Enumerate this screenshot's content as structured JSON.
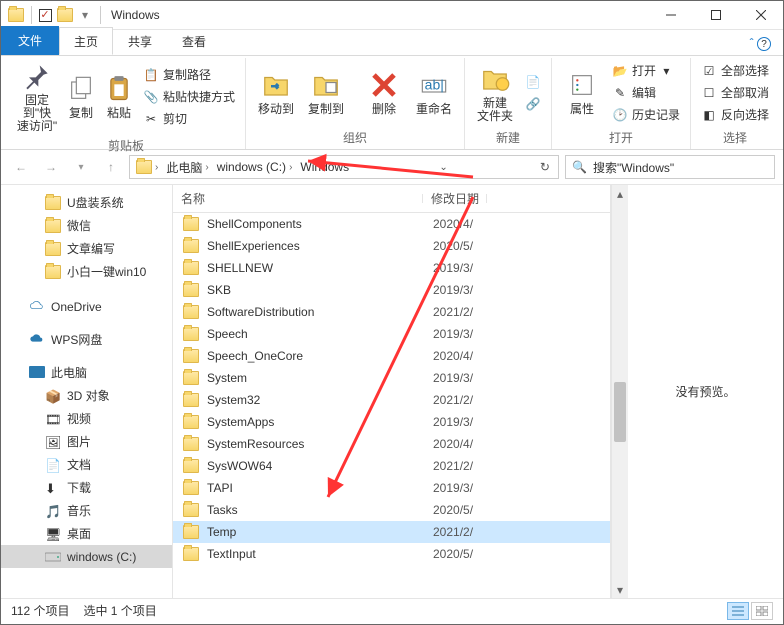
{
  "window": {
    "title": "Windows"
  },
  "tabs": {
    "file": "文件",
    "home": "主页",
    "share": "共享",
    "view": "查看"
  },
  "ribbon": {
    "clipboard": {
      "pin": "固定到\"快\n速访问\"",
      "copy": "复制",
      "paste": "粘贴",
      "copy_path": "复制路径",
      "paste_shortcut": "粘贴快捷方式",
      "cut": "剪切",
      "label": "剪贴板"
    },
    "organize": {
      "moveto": "移动到",
      "copyto": "复制到",
      "delete": "删除",
      "rename": "重命名",
      "label": "组织"
    },
    "new": {
      "newfolder": "新建\n文件夹",
      "label": "新建"
    },
    "open": {
      "props": "属性",
      "open": "打开",
      "edit": "编辑",
      "history": "历史记录",
      "label": "打开"
    },
    "select": {
      "all": "全部选择",
      "none": "全部取消",
      "invert": "反向选择",
      "label": "选择"
    }
  },
  "breadcrumb": {
    "thispc": "此电脑",
    "drive": "windows (C:)",
    "folder": "Windows"
  },
  "search": {
    "placeholder": "搜索\"Windows\""
  },
  "sidebar": {
    "items": [
      {
        "label": "U盘装系统",
        "icon": "folder"
      },
      {
        "label": "微信",
        "icon": "folder"
      },
      {
        "label": "文章编写",
        "icon": "folder"
      },
      {
        "label": "小白一键win10",
        "icon": "folder"
      }
    ],
    "onedrive": "OneDrive",
    "wps": "WPS网盘",
    "thispc": "此电脑",
    "pcitems": [
      {
        "label": "3D 对象"
      },
      {
        "label": "视频"
      },
      {
        "label": "图片"
      },
      {
        "label": "文档"
      },
      {
        "label": "下载"
      },
      {
        "label": "音乐"
      },
      {
        "label": "桌面"
      }
    ],
    "drive": "windows (C:)"
  },
  "columns": {
    "name": "名称",
    "modified": "修改日期"
  },
  "files": [
    {
      "name": "ShellComponents",
      "date": "2020/4/"
    },
    {
      "name": "ShellExperiences",
      "date": "2020/5/"
    },
    {
      "name": "SHELLNEW",
      "date": "2019/3/"
    },
    {
      "name": "SKB",
      "date": "2019/3/"
    },
    {
      "name": "SoftwareDistribution",
      "date": "2021/2/"
    },
    {
      "name": "Speech",
      "date": "2019/3/"
    },
    {
      "name": "Speech_OneCore",
      "date": "2020/4/"
    },
    {
      "name": "System",
      "date": "2019/3/"
    },
    {
      "name": "System32",
      "date": "2021/2/"
    },
    {
      "name": "SystemApps",
      "date": "2019/3/"
    },
    {
      "name": "SystemResources",
      "date": "2020/4/"
    },
    {
      "name": "SysWOW64",
      "date": "2021/2/"
    },
    {
      "name": "TAPI",
      "date": "2019/3/"
    },
    {
      "name": "Tasks",
      "date": "2020/5/"
    },
    {
      "name": "Temp",
      "date": "2021/2/",
      "selected": true
    },
    {
      "name": "TextInput",
      "date": "2020/5/"
    }
  ],
  "preview": {
    "nopreview": "没有预览。"
  },
  "status": {
    "count": "112 个项目",
    "selected": "选中 1 个项目"
  }
}
